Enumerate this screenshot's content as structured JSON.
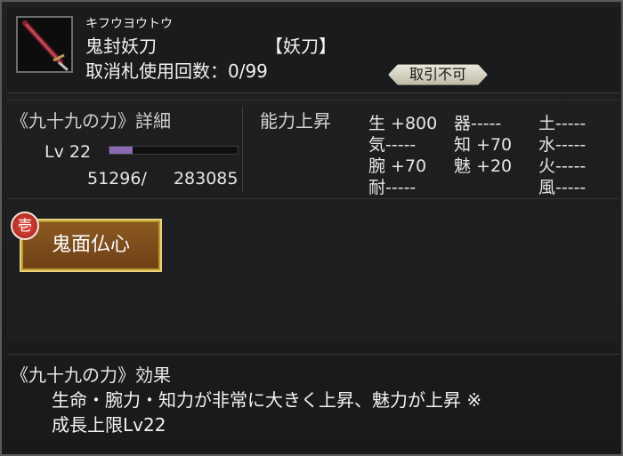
{
  "item": {
    "ruby": "キフウヨウトウ",
    "name": "鬼封妖刀",
    "type": "【妖刀】",
    "cancel_label": "取消札使用回数：0/99",
    "trade_status": "取引不可",
    "thumbnail_icon": "katana-icon"
  },
  "power_section": {
    "title": "《九十九の力》詳細",
    "level_text": "Lv 22",
    "exp_current": "51296/",
    "exp_max": "283085",
    "exp_progress_percent": 18
  },
  "ability": {
    "label": "能力上昇",
    "stats": [
      {
        "text": "生 +800"
      },
      {
        "text": "器-----"
      },
      {
        "text": "土-----"
      },
      {
        "text": "気-----"
      },
      {
        "text": "知  +70"
      },
      {
        "text": "水-----"
      },
      {
        "text": "腕  +70"
      },
      {
        "text": "魅  +20"
      },
      {
        "text": "火-----"
      },
      {
        "text": "耐-----"
      },
      {
        "text": "風-----"
      }
    ]
  },
  "skill": {
    "slot_number": "壱",
    "label": "鬼面仏心"
  },
  "effect": {
    "title": "《九十九の力》効果",
    "line1": "生命・腕力・知力が非常に大きく上昇、魅力が上昇 ※",
    "line2": "成長上限Lv22"
  },
  "colors": {
    "background": "#1b1c1d",
    "exp_bar": "#8b6ab3",
    "skill_button": "#7b4a1b",
    "skill_border": "#e9d27a",
    "skill_number": "#c7302a"
  }
}
